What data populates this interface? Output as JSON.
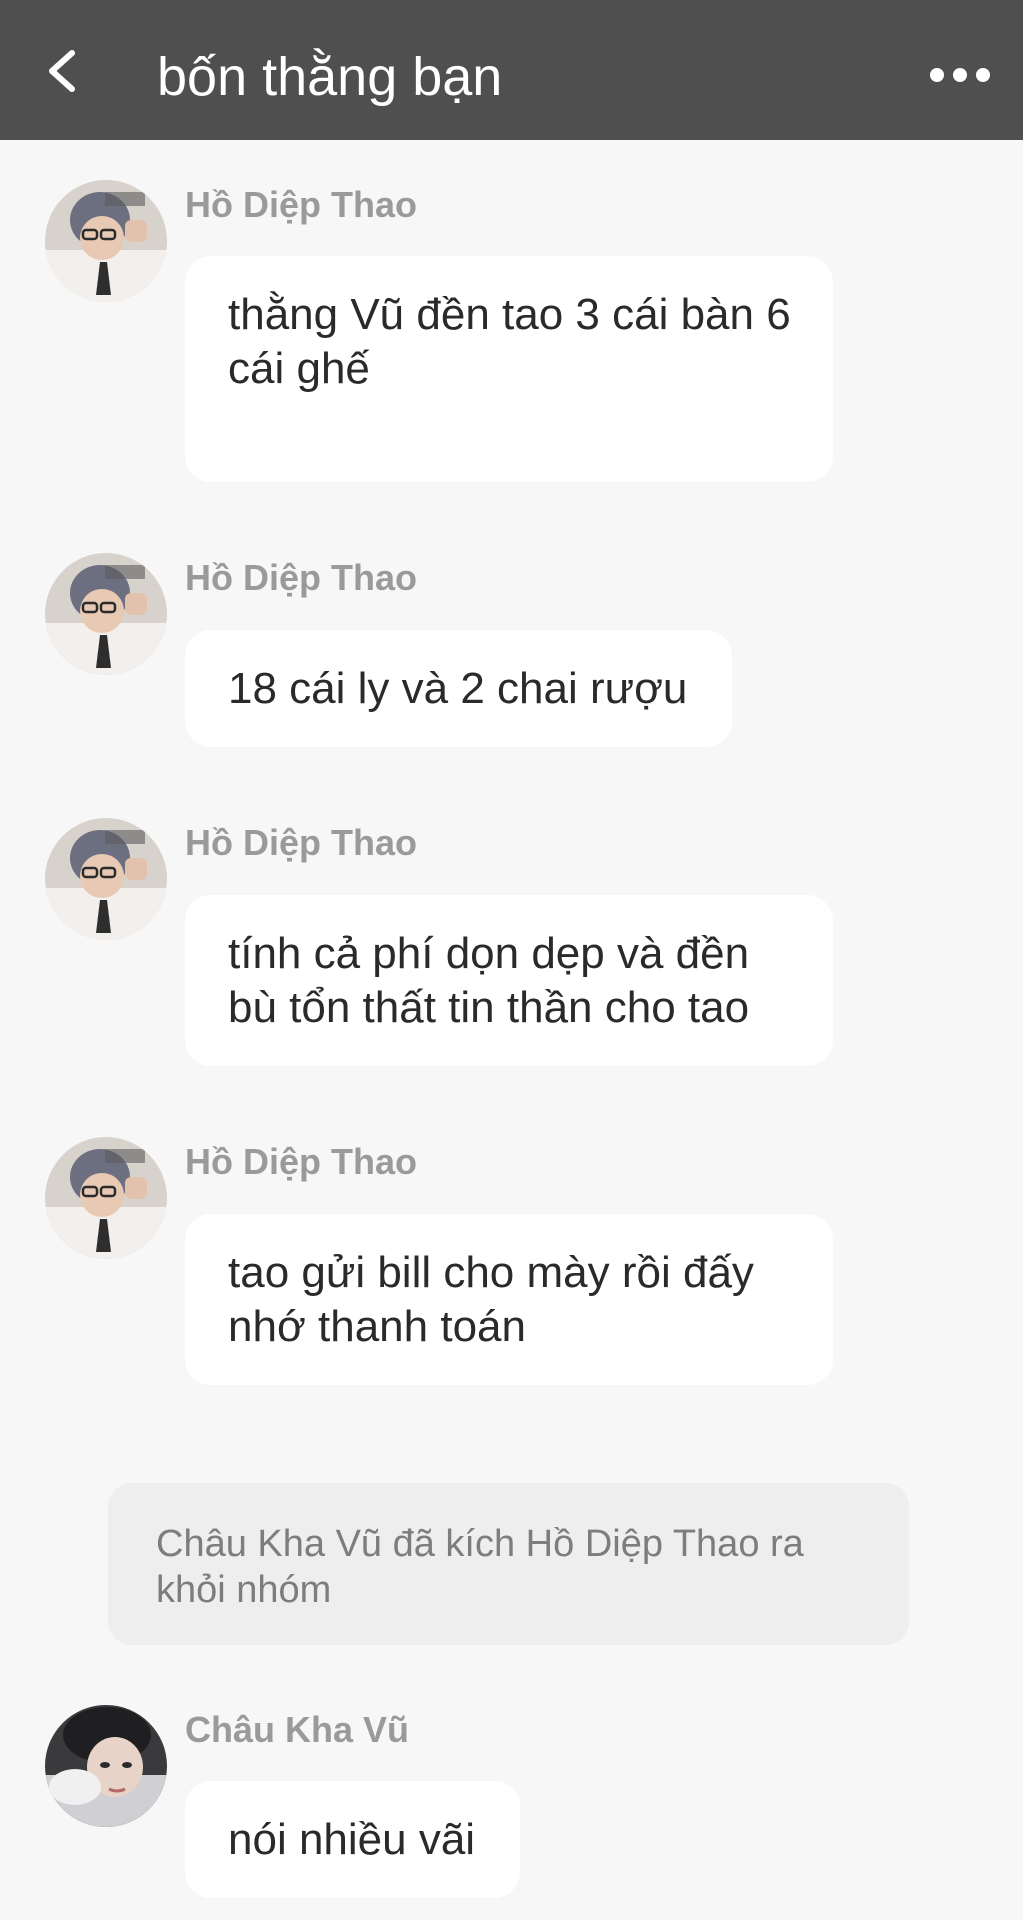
{
  "header": {
    "title": "bốn thằng bạn",
    "back_icon": "chevron-left-icon",
    "more_icon": "more-horizontal-icon",
    "background_color": "#4f4f4f"
  },
  "messages": [
    {
      "sender": "Hồ Diệp Thao",
      "text": "thằng Vũ đền tao 3 cái bàn 6 cái ghế"
    },
    {
      "sender": "Hồ Diệp Thao",
      "text": "18 cái ly và 2 chai rượu"
    },
    {
      "sender": "Hồ Diệp Thao",
      "text": "tính cả phí dọn dẹp và đền bù tổn thất tin thần cho tao"
    },
    {
      "sender": "Hồ Diệp Thao",
      "text": "tao gửi bill cho mày rồi đấy nhớ thanh toán"
    }
  ],
  "system_notice": {
    "text": "Châu Kha Vũ đã kích Hồ Diệp Thao ra khỏi nhóm"
  },
  "last_message": {
    "sender": "Châu Kha Vũ",
    "text": "nói nhiều vãi"
  }
}
